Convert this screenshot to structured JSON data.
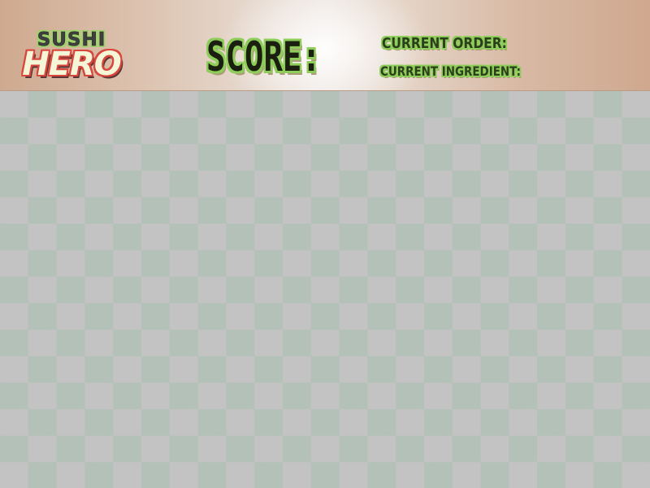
{
  "logo": {
    "line1": "SUSHI",
    "line2": "HERO"
  },
  "hud": {
    "score_label": "SCORE:",
    "score_value": "",
    "current_order_label": "CURRENT ORDER:",
    "current_order_value": "",
    "current_ingredient_label": "CURRENT INGREDIENT:",
    "current_ingredient_value": ""
  },
  "board": {
    "columns": 23,
    "rows": 15,
    "tiles": []
  },
  "colors": {
    "hud_background": "#dcc3b0",
    "text_outline_green": "#8fcd5a",
    "logo_red": "#d8473d",
    "tile_light": "#c3c3c3",
    "tile_green": "#b3c1b8"
  }
}
